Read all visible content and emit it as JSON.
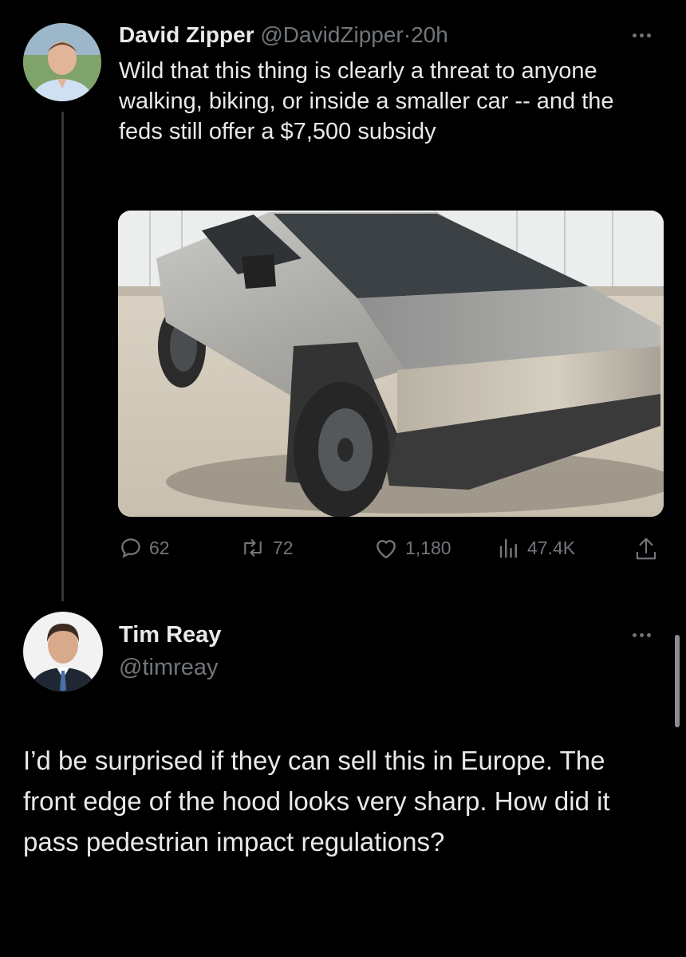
{
  "tweet1": {
    "author_name": "David Zipper",
    "handle": "@DavidZipper",
    "separator": "·",
    "time": "20h",
    "text": "Wild that this thing is clearly a threat to anyone walking, biking, or inside a smaller car -- and the feds still offer a $7,500 subsidy",
    "actions": {
      "replies": "62",
      "reposts": "72",
      "likes": "1,180",
      "views": "47.4K"
    }
  },
  "tweet2": {
    "author_name": "Tim Reay",
    "handle": "@timreay",
    "text": "I’d be surprised if they can sell this in Europe. The front edge of the hood looks very sharp. How did it pass pedestrian impact regulations?"
  },
  "icons": [
    "more-icon",
    "reply-icon",
    "repost-icon",
    "like-icon",
    "views-icon",
    "share-icon"
  ],
  "colors": {
    "background": "#000000",
    "text": "#e7e9ea",
    "muted": "#71767b",
    "thread_line": "#333639"
  }
}
